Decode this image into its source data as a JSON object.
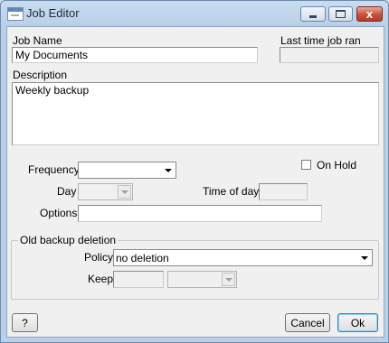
{
  "window": {
    "title": "Job Editor",
    "app_icon": "window-icon",
    "controls": [
      "minimize-icon",
      "maximize-icon",
      "close-icon"
    ],
    "close_glyph": "x"
  },
  "job_name": {
    "label": "Job Name",
    "value": "My Documents"
  },
  "last_run": {
    "label": "Last time job ran",
    "value": ""
  },
  "description": {
    "label": "Description",
    "value": "Weekly backup"
  },
  "schedule": {
    "on_hold_label": "On Hold",
    "on_hold_checked": false,
    "frequency_label": "Frequency",
    "frequency_value": "",
    "day_label": "Day",
    "day_value": "",
    "time_of_day_label": "Time of day",
    "time_of_day_value": "",
    "options_label": "Options",
    "options_value": ""
  },
  "old_backup_deletion": {
    "title": "Old backup deletion",
    "policy_label": "Policy",
    "policy_value": "no deletion",
    "keep_label": "Keep",
    "keep_count": "",
    "keep_unit": ""
  },
  "buttons": {
    "help": "?",
    "cancel": "Cancel",
    "ok": "Ok"
  },
  "colors": {
    "title_bar": "#b9d0e8",
    "client_bg": "#f0f0f0",
    "close_button": "#c8503b"
  }
}
